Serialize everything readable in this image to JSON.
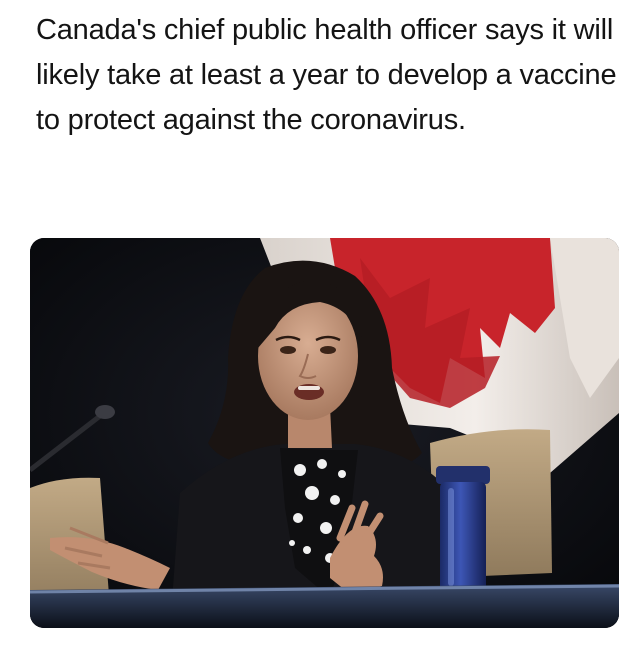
{
  "post": {
    "caption": "Canada's chief public health officer says it will likely take at least a year to develop a vaccine to protect against the coronavirus."
  },
  "photo": {
    "subject": "woman-speaking-at-press-conference",
    "background": "canadian-flag",
    "colors": {
      "backdrop": "#0c0d12",
      "flag_red": "#c8242b",
      "flag_white": "#efe9e4",
      "chair": "#b39b79",
      "blazer": "#16161a",
      "skin": "#c99a7e",
      "hair": "#1a1412",
      "tumbler": "#2a3f8f"
    }
  }
}
